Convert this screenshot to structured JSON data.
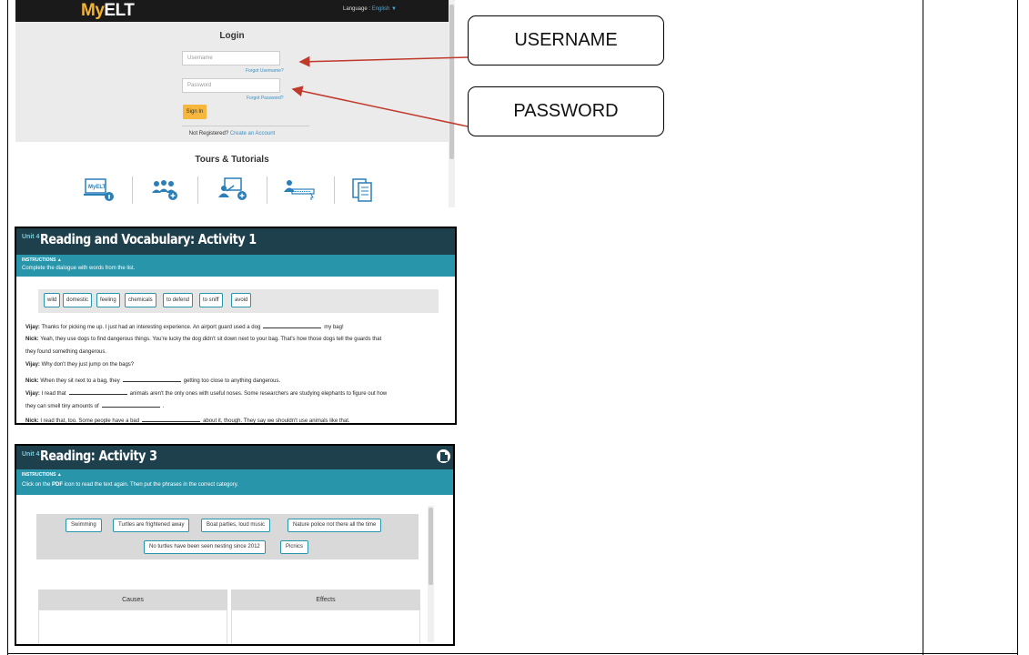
{
  "login_panel": {
    "logo_my": "My",
    "logo_elt": "ELT",
    "language_label": "Language :",
    "language_value": "English ▼",
    "title": "Login",
    "username_placeholder": "Username",
    "forgot_username": "Forgot Username?",
    "password_placeholder": "Password",
    "forgot_password": "Forgot Password?",
    "sign_in": "Sign In",
    "not_registered": "Not Registered?",
    "create_account": "Create an Account",
    "tours_title": "Tours & Tutorials",
    "tour_icons": [
      "myelt-info-icon",
      "group-add-icon",
      "teacher-add-icon",
      "typing-user-icon",
      "documents-icon"
    ],
    "myelt_icon_text": "MyELT"
  },
  "callouts": {
    "username": "USERNAME",
    "password": "PASSWORD"
  },
  "vocab_panel": {
    "unit_label": "Unit 4",
    "title": "Reading and Vocabulary: Activity 1",
    "instructions_label": "INSTRUCTIONS ▲",
    "instructions_text": "Complete the dialogue with words from the list.",
    "words": [
      "wild",
      "domestic",
      "feeling",
      "chemicals",
      "to defend",
      "to sniff",
      "avoid"
    ],
    "dialogue": [
      {
        "speaker": "Vijay:",
        "before": "Thanks for picking me up. I just had an interesting experience. An airport guard used a dog",
        "after": "my bag!"
      },
      {
        "speaker": "Nick:",
        "before": "Yeah, they use dogs to find dangerous things. You're lucky the dog didn't sit down next to your bag. That's how those dogs tell the guards that",
        "after": ""
      },
      {
        "speaker": "",
        "before": "they found something dangerous.",
        "after": ""
      },
      {
        "speaker": "Vijay:",
        "before": "Why don't they just jump on the bags?",
        "after": ""
      },
      {
        "speaker": "Nick:",
        "before": "When they sit next to a bag, they",
        "after": "getting too close to anything dangerous."
      },
      {
        "speaker": "Vijay:",
        "before": "I read that",
        "after": "animals aren't the only ones with useful noses. Some researchers are studying elephants to figure out how"
      },
      {
        "speaker": "",
        "before": "they can smell tiny amounts of",
        "after": "."
      },
      {
        "speaker": "Nick:",
        "before": "I read that, too. Some people have a bad",
        "after": "about it, though. They say we shouldn't use animals like that."
      }
    ]
  },
  "reading_panel": {
    "unit_label": "Unit 4",
    "title": "Reading: Activity 3",
    "instructions_label": "INSTRUCTIONS ▲",
    "instructions_before": "Click on the",
    "instructions_pdf": "PDF",
    "instructions_after": "icon to read the text again. Then put the phrases in the correct category.",
    "phrases_row1": [
      "Swimming",
      "Turtles are frightened away",
      "Boat parties, loud music",
      "Nature police not there all the time"
    ],
    "phrases_row2": [
      "No turtles have been seen nesting since 2012",
      "Picnics"
    ],
    "col_causes": "Causes",
    "col_effects": "Effects"
  },
  "colors": {
    "header_dark": "#1e3f4c",
    "instructions_teal": "#2995ab",
    "sign_in_yellow": "#f6b73c",
    "arrow_red": "#c0392b"
  }
}
